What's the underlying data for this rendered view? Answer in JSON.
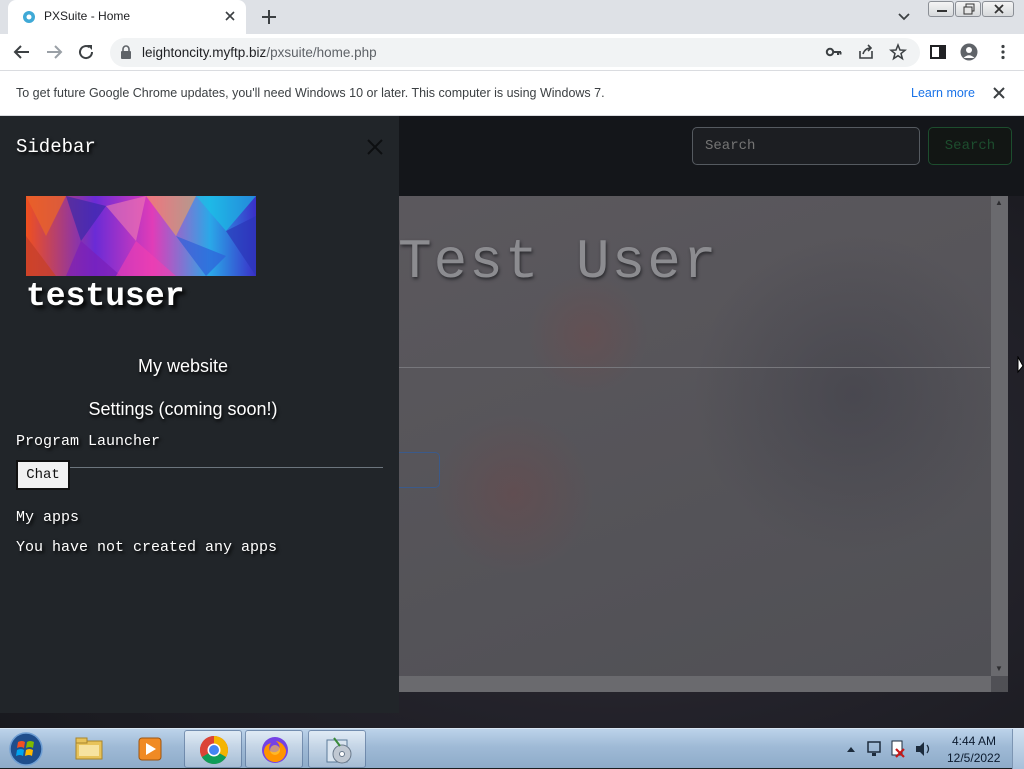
{
  "browser": {
    "tab_title": "PXSuite - Home",
    "url_host": "leightoncity.myftp.biz",
    "url_path": "/pxsuite/home.php"
  },
  "infobar": {
    "message": "To get future Google Chrome updates, you'll need Windows 10 or later. This computer is using Windows 7.",
    "learn_more": "Learn more"
  },
  "navbar": {
    "search_placeholder": "Search",
    "search_button": "Search"
  },
  "content": {
    "welcome_title": "Test User"
  },
  "sidebar": {
    "title": "Sidebar",
    "username": "testuser",
    "link_website": "My website",
    "link_settings": "Settings (coming soon!)",
    "program_launcher": "Program Launcher",
    "chat_button": "Chat",
    "my_apps_heading": "My apps",
    "no_apps_text": "You have not created any apps"
  },
  "taskbar": {
    "apps": [
      "start-orb",
      "explorer",
      "media-player",
      "chrome",
      "firefox",
      "setup-wizard"
    ],
    "active_app": "chrome",
    "time": "4:44 AM",
    "date": "12/5/2022"
  },
  "colors": {
    "sidebar_bg": "#212529",
    "accent_link": "#1a73e8",
    "search_button_border": "#1d4d2e"
  }
}
